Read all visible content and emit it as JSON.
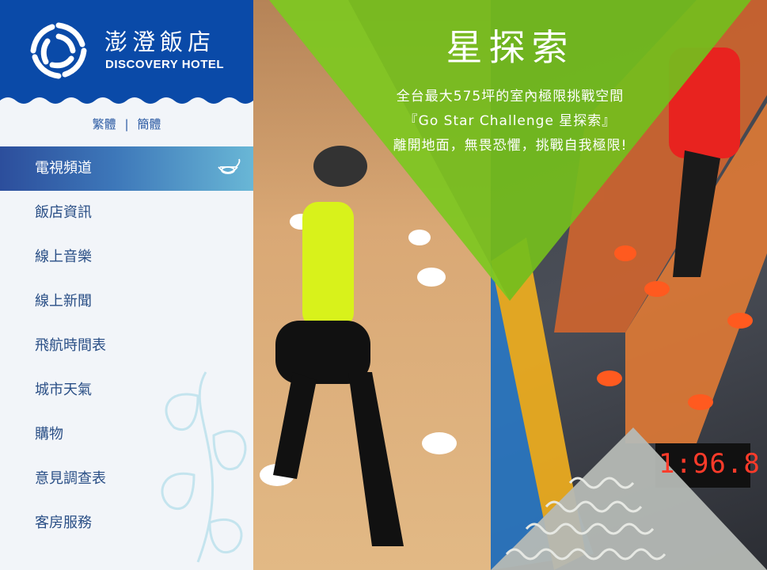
{
  "brand": {
    "name_zh": "澎澄飯店",
    "name_en": "DISCOVERY HOTEL"
  },
  "language": {
    "traditional": "繁體",
    "separator": "|",
    "simplified": "簡體"
  },
  "menu": {
    "items": [
      {
        "label": "電視頻道",
        "active": true
      },
      {
        "label": "飯店資訊"
      },
      {
        "label": "線上音樂"
      },
      {
        "label": "線上新聞"
      },
      {
        "label": "飛航時間表"
      },
      {
        "label": "城市天氣"
      },
      {
        "label": "購物"
      },
      {
        "label": "意見調查表"
      },
      {
        "label": "客房服務"
      }
    ]
  },
  "promo": {
    "title": "星探索",
    "line1": "全台最大575坪的室內極限挑戰空間",
    "line2": "『Go Star Challenge 星探索』",
    "line3": "離開地面，無畏恐懼，挑戰自我極限!",
    "timer": "1:96.8"
  },
  "colors": {
    "brand_blue": "#0a4aa8",
    "menu_text": "#2a4f86",
    "active_gradient_start": "#2c4e9c",
    "active_gradient_end": "#69b7d6",
    "promo_green": "#7bc21f"
  },
  "icons": {
    "logo": "discovery-hotel-logo",
    "active_item": "cup-icon",
    "decoration": "leaf-pattern"
  }
}
